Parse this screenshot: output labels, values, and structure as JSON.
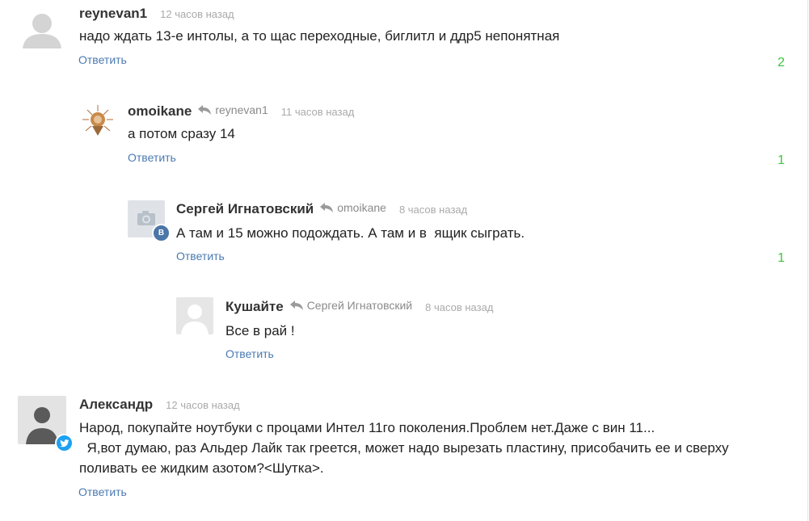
{
  "comments": [
    {
      "author": "reynevan1",
      "reply_to": "",
      "time": "12 часов назад",
      "text": "надо ждать 13-е интолы, а то щас переходные, биглитл и ддр5 непонятная",
      "reply_label": "Ответить",
      "score": "2",
      "avatar_icon": "default-user-icon"
    },
    {
      "author": "omoikane",
      "reply_to": "reynevan1",
      "time": "11 часов назад",
      "text": "а потом сразу 14",
      "reply_label": "Ответить",
      "score": "1",
      "avatar_icon": "custom-avatar-icon"
    },
    {
      "author": "Сергей Игнатовский",
      "reply_to": "omoikane",
      "time": "8 часов назад",
      "text": "А там и 15 можно подождать. А там и в  ящик сыграть.",
      "reply_label": "Ответить",
      "score": "1",
      "avatar_icon": "camera-icon",
      "badge_label": "B",
      "badge_icon": "vk-badge-icon",
      "badge_color": "#4a76a8"
    },
    {
      "author": "Кушайте",
      "reply_to": "Сергей Игнатовский",
      "time": "8 часов назад",
      "text": "Все в рай !",
      "reply_label": "Ответить",
      "score": "",
      "avatar_icon": "default-user-icon"
    },
    {
      "author": "Александр",
      "reply_to": "",
      "time": "12 часов назад",
      "text": "Народ, покупайте ноутбуки с процами Интел 11го поколения.Проблем нет.Даже с вин 11...\n  Я,вот думаю, раз Альдер Лайк так греется, может надо вырезать пластину, присобачить ее и сверху поливать ее жидким азотом?<Шутка>.",
      "reply_label": "Ответить",
      "score": "",
      "avatar_icon": "default-user-icon",
      "badge_icon": "twitter-badge-icon",
      "badge_color": "#1da1f2"
    }
  ],
  "colors": {
    "link": "#4a7ab1",
    "score": "#3cc43c",
    "time": "#aaaaaa"
  }
}
